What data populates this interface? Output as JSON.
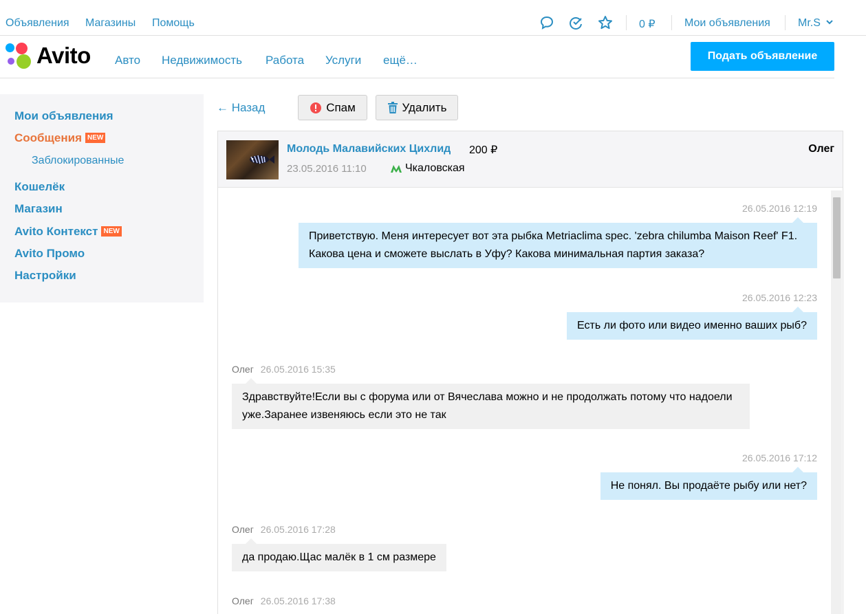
{
  "topbar": {
    "links": [
      "Объявления",
      "Магазины",
      "Помощь"
    ],
    "balance": "0 ₽",
    "my_ads": "Мои объявления",
    "user": "Mr.S"
  },
  "header": {
    "logo": "Avito",
    "nav": [
      "Авто",
      "Недвижимость",
      "Работа",
      "Услуги",
      "ещё…"
    ],
    "post_button": "Подать объявление"
  },
  "sidebar": {
    "items": [
      {
        "label": "Мои объявления"
      },
      {
        "label": "Сообщения",
        "badge": "NEW"
      },
      {
        "label": "Заблокированные"
      },
      {
        "label": "Кошелёк"
      },
      {
        "label": "Магазин"
      },
      {
        "label": "Avito Контекст",
        "badge": "NEW"
      },
      {
        "label": "Avito Промо"
      },
      {
        "label": "Настройки"
      }
    ]
  },
  "actions": {
    "back": "← Назад",
    "spam": "Спам",
    "delete": "Удалить"
  },
  "item": {
    "title": "Молодь Малавийских Цихлид",
    "price": "200 ₽",
    "date": "23.05.2016 11:10",
    "metro": "Чкаловская",
    "user": "Олег"
  },
  "messages": [
    {
      "dir": "out",
      "time": "26.05.2016 12:19",
      "text": "Приветствую. Меня интересует вот эта рыбка Metriaclima spec. 'zebra chilumba Maison Reef' F1. Какова цена и сможете выслать в Уфу? Какова минимальная партия заказа?"
    },
    {
      "dir": "out",
      "time": "26.05.2016 12:23",
      "text": "Есть ли фото или видео именно ваших рыб?"
    },
    {
      "dir": "in",
      "author": "Олег",
      "time": "26.05.2016 15:35",
      "text": "Здравствуйте!Если вы с форума или от Вячеслава можно и не продолжать потому что надоели уже.Заранее извеняюсь если это не так"
    },
    {
      "dir": "out",
      "time": "26.05.2016 17:12",
      "text": "Не понял. Вы продаёте рыбу или нет?"
    },
    {
      "dir": "in",
      "author": "Олег",
      "time": "26.05.2016 17:28",
      "text": "да продаю.Щас малёк в 1 см размере"
    },
    {
      "dir": "in",
      "author": "Олег",
      "time": "26.05.2016 17:38",
      "text": ""
    }
  ],
  "colors": {
    "link": "#2b8ec2",
    "accent": "#00aaff",
    "active": "#e8743b",
    "badge": "#ff6a35",
    "bubble_out": "#d1ecfb",
    "bubble_in": "#f0f0f0"
  }
}
